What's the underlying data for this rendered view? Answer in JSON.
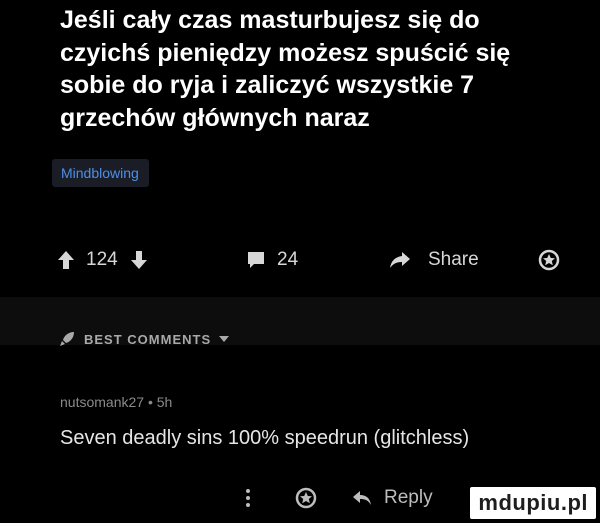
{
  "post": {
    "title": "Jeśli cały czas masturbujesz się do czyichś pieniędzy możesz spuścić się sobie do ryja i zaliczyć wszystkie 7 grzechów głównych naraz",
    "tag": "Mindblowing"
  },
  "actions": {
    "upvote_count": "124",
    "comment_count": "24",
    "share_label": "Share"
  },
  "comments_header": {
    "label": "BEST COMMENTS"
  },
  "comment": {
    "meta": "nutsomank27 • 5h",
    "text": "Seven deadly sins 100% speedrun (glitchless)",
    "reply_label": "Reply"
  },
  "watermark": "mdupiu.pl",
  "icons": {
    "upvote": "arrow-up-icon",
    "downvote": "arrow-down-icon",
    "comment": "comment-bubble-icon",
    "share": "share-arrow-icon",
    "award": "award-icon",
    "best": "rocket-icon",
    "dropdown": "chevron-down-icon",
    "more": "more-vertical-icon",
    "reply": "reply-icon"
  },
  "colors": {
    "background": "#000000",
    "tag_text": "#4e8fe8",
    "tag_bg": "#1a1d26",
    "muted": "#8a8a8a"
  }
}
